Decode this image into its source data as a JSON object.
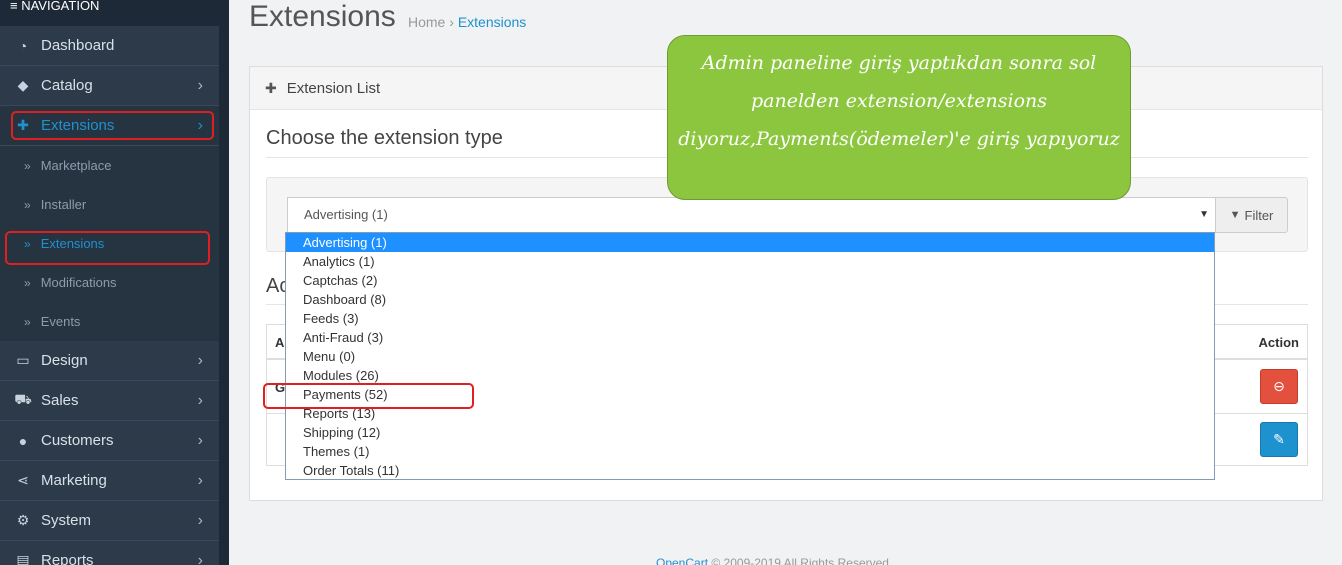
{
  "sidebar": {
    "title": "≡ NAVIGATION",
    "items": [
      {
        "label": "Dashboard",
        "icon": "dashboard-icon"
      },
      {
        "label": "Catalog",
        "icon": "tag-icon"
      },
      {
        "label": "Extensions",
        "icon": "puzzle-icon"
      },
      {
        "label": "Design",
        "icon": "monitor-icon"
      },
      {
        "label": "Sales",
        "icon": "cart-icon"
      },
      {
        "label": "Customers",
        "icon": "user-icon"
      },
      {
        "label": "Marketing",
        "icon": "share-icon"
      },
      {
        "label": "System",
        "icon": "gear-icon"
      },
      {
        "label": "Reports",
        "icon": "chart-icon"
      }
    ],
    "sub_items": [
      "Marketplace",
      "Installer",
      "Extensions",
      "Modifications",
      "Events"
    ]
  },
  "header": {
    "title": "Extensions",
    "breadcrumb": {
      "home": "Home",
      "separator": "›",
      "current": "Extensions"
    }
  },
  "panel": {
    "heading": "Extension List",
    "choose_heading": "Choose the extension type",
    "select_value": "Advertising (1)",
    "filter_label": "Filter",
    "added_heading_fragment": "Ac",
    "table": {
      "col_left_fragment": "A",
      "col_action": "Action",
      "row_fragment": "G"
    }
  },
  "dropdown": {
    "options": [
      "Advertising (1)",
      "Analytics (1)",
      "Captchas (2)",
      "Dashboard (8)",
      "Feeds (3)",
      "Anti-Fraud (3)",
      "Menu (0)",
      "Modules (26)",
      "Payments (52)",
      "Reports (13)",
      "Shipping (12)",
      "Themes (1)",
      "Order Totals (11)"
    ],
    "selected_index": 0
  },
  "annotation": {
    "text": "Admin paneline giriş yaptıkdan sonra sol panelden extension/extensions diyoruz,Payments(ödemeler)'e giriş yapıyoruz",
    "bg_color": "#8cc63f",
    "highlight_color": "#e02020"
  },
  "footer": {
    "link": "OpenCart",
    "text": "© 2009-2019 All Rights Reserved."
  },
  "colors": {
    "sidebar": "#2d3a4a",
    "accent": "#1e91cf",
    "danger": "#e3503e"
  }
}
